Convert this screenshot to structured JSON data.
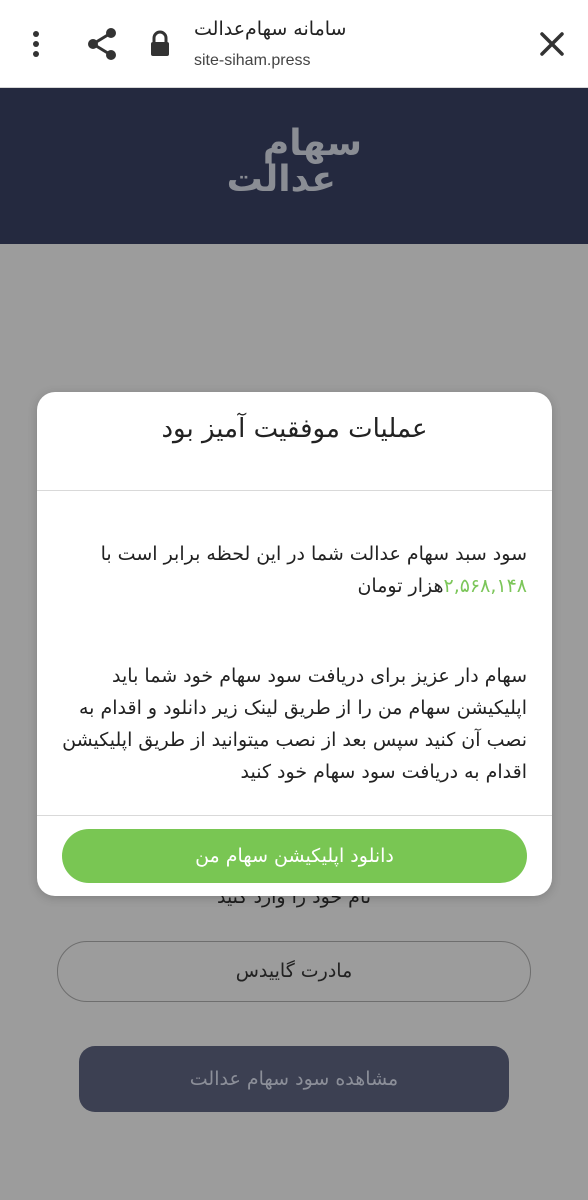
{
  "browser": {
    "page_title": "سامانه سهام‌عدالت",
    "url": "site-siham.press"
  },
  "site": {
    "logo_line1": "سهام",
    "logo_line2": "عدالت"
  },
  "form": {
    "name_label": "نام خود را وارد کنید",
    "name_value": "مادرت گاییدس",
    "submit_label": "مشاهده سود سهام عدالت"
  },
  "modal": {
    "title": "عملیات موفقیت آمیز بود",
    "profit_text_before": "سود سبد سهام عدالت شما در این لحظه برابر است با ",
    "profit_amount": "۲,۵۶۸,۱۴۸",
    "profit_unit": "هزار تومان",
    "instructions": "سهام دار عزیز برای دریافت سود سهام خود شما باید اپلیکیشن سهام من را از طریق لینک زیر دانلود و اقدام به نصب آن کنید سپس بعد از نصب میتوانید از طریق اپلیکیشن اقدام به دریافت سود سهام خود کنید",
    "download_button": "دانلود اپلیکیشن سهام من"
  },
  "colors": {
    "header_bg": "#24293f",
    "accent_green": "#79c653",
    "amount_green": "#7cc65a",
    "overlay_gray": "#9c9c9c"
  },
  "icons": [
    "more-vert-icon",
    "share-icon",
    "lock-icon",
    "close-icon"
  ]
}
